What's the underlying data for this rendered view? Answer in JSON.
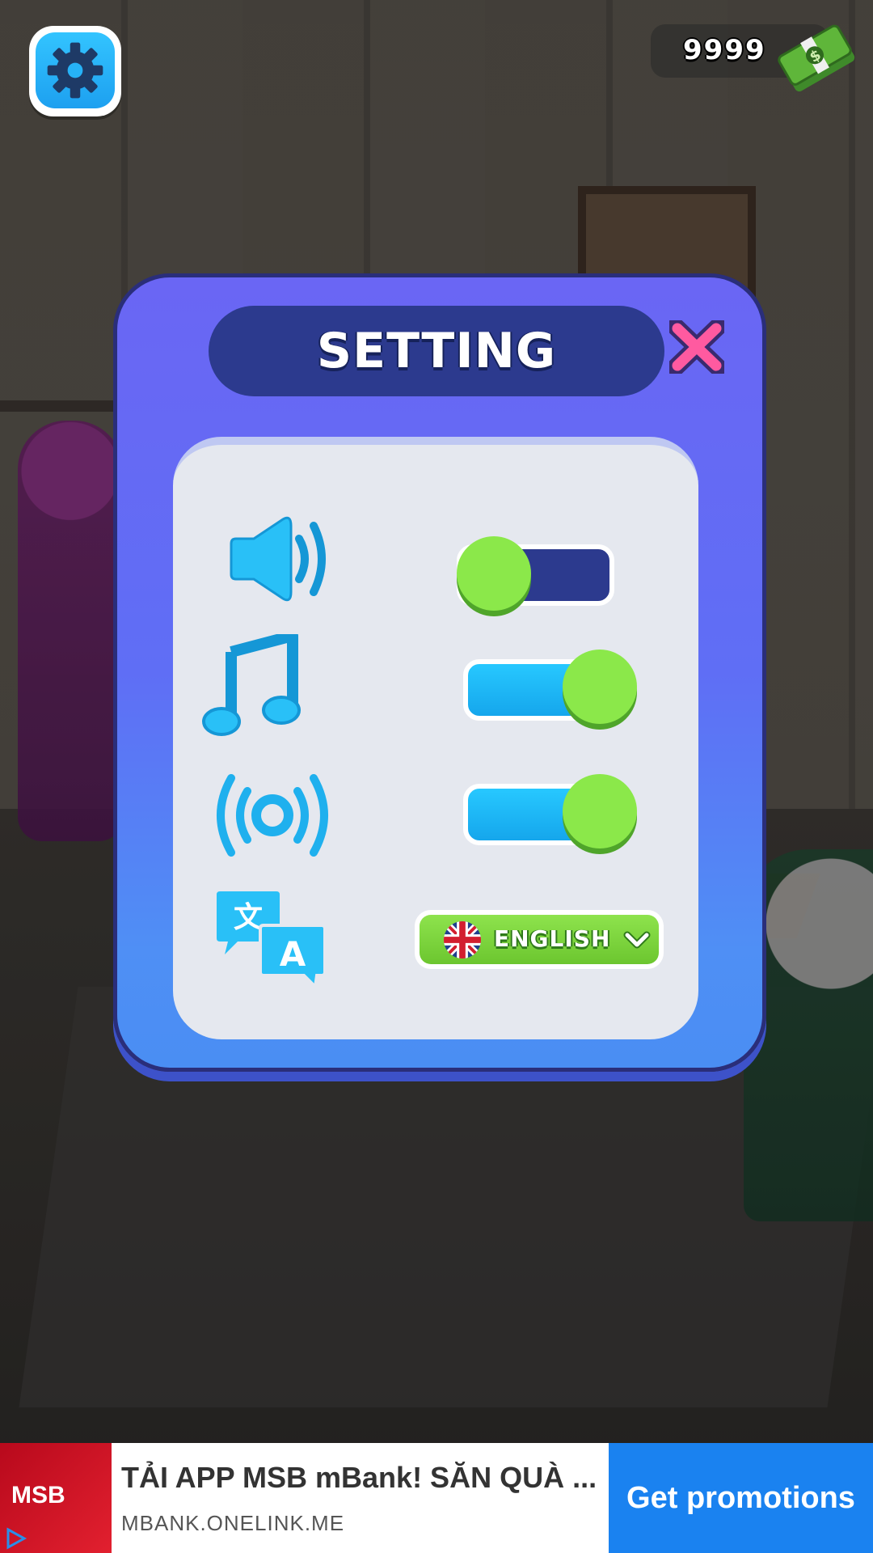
{
  "hud": {
    "coins": "9999",
    "settings_icon": "gear-icon",
    "currency_icon": "cash-stack-icon"
  },
  "dialog": {
    "title": "SETTING",
    "close_icon": "close-x-icon",
    "rows": [
      {
        "id": "sound",
        "icon": "speaker-icon",
        "state": "off"
      },
      {
        "id": "music",
        "icon": "music-note-icon",
        "state": "on"
      },
      {
        "id": "vibration",
        "icon": "vibration-icon",
        "state": "on"
      },
      {
        "id": "language",
        "icon": "translate-icon",
        "value": "ENGLISH",
        "flag_icon": "uk-flag-icon"
      }
    ]
  },
  "ad": {
    "brand": "MSB",
    "title": "TẢI APP MSB mBank! SĂN QUÀ ...",
    "url": "MBANK.ONELINK.ME",
    "cta": "Get promotions"
  },
  "colors": {
    "panel": "#6a66f4",
    "toggle_on": "#27c8ff",
    "toggle_off": "#2c3a8e",
    "knob": "#8be84a",
    "ad_cta": "#1a82f0"
  }
}
